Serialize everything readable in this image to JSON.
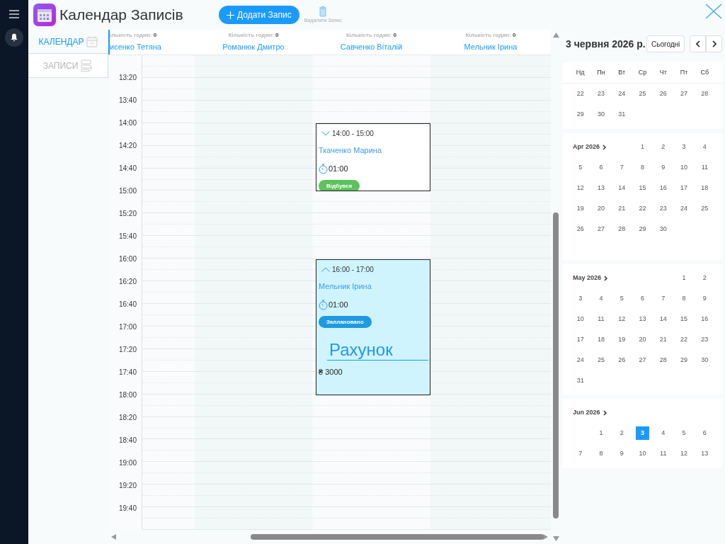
{
  "app": {
    "title": "Календар Записів",
    "add_button": "Додати Запис",
    "delete_button": "Видалити Запис"
  },
  "nav": [
    {
      "label": "КАЛЕНДАР",
      "kind": "calendar",
      "selected": true
    },
    {
      "label": "ЗАПИСИ",
      "kind": "records",
      "selected": false
    }
  ],
  "staff_columns": [
    {
      "hours_label": "ількість годин:",
      "hours": "0",
      "name": "исенко Тетяна"
    },
    {
      "hours_label": "Кількість годин:",
      "hours": "0",
      "name": "Романюк Дмитро"
    },
    {
      "hours_label": "Кількість годин:",
      "hours": "0",
      "name": "Савченко Віталій",
      "events": [
        {
          "time": "14:00 - 15:00",
          "client": "Ткаченко Марина",
          "duration": "01:00",
          "status": "Відбувся",
          "color": "#5cc35c",
          "expanded": false
        },
        {
          "time": "16:00 - 17:00",
          "client": "Мельник Ірина",
          "duration": "01:00",
          "status": "Заплановано",
          "color": "#1e9be0",
          "expanded": true,
          "invoice_label": "Рахунок",
          "amount": "₴ 3000"
        }
      ]
    },
    {
      "hours_label": "Кількість годин:",
      "hours": "0",
      "name": "Мельник Ірина"
    }
  ],
  "times": [
    "13:20",
    "13:40",
    "14:00",
    "14:20",
    "14:40",
    "15:00",
    "15:20",
    "15:40",
    "16:00",
    "16:20",
    "16:40",
    "17:00",
    "17:20",
    "17:40",
    "18:00",
    "18:20",
    "18:40",
    "19:00",
    "19:20",
    "19:40"
  ],
  "calendar": {
    "date_title": "3 червня 2026 р.",
    "today_button": "Сьогодні",
    "weekdays": [
      "Нд",
      "Пн",
      "Вт",
      "Ср",
      "Чт",
      "Пт",
      "Сб"
    ],
    "months": [
      {
        "weeks": [
          [
            {
              "d": "22",
              "selected": false
            },
            {
              "d": "23",
              "selected": false
            },
            {
              "d": "24",
              "selected": false
            },
            {
              "d": "25",
              "selected": false
            },
            {
              "d": "26",
              "selected": false
            },
            {
              "d": "27",
              "selected": false
            },
            {
              "d": "28",
              "selected": false
            }
          ],
          [
            {
              "d": "29",
              "selected": false
            },
            {
              "d": "30",
              "selected": false
            },
            {
              "d": "31",
              "selected": false
            }
          ]
        ]
      },
      {
        "label": "Apr 2026",
        "weeks": [
          [
            {
              "kind": "blank"
            },
            {
              "kind": "blank"
            },
            {
              "kind": "blank"
            },
            {
              "d": "1",
              "selected": false
            },
            {
              "d": "2",
              "selected": false
            },
            {
              "d": "3",
              "selected": false
            },
            {
              "d": "4",
              "selected": false
            }
          ],
          [
            {
              "d": "5",
              "selected": false
            },
            {
              "d": "6",
              "selected": false
            },
            {
              "d": "7",
              "selected": false
            },
            {
              "d": "8",
              "selected": false
            },
            {
              "d": "9",
              "selected": false
            },
            {
              "d": "10",
              "selected": false
            },
            {
              "d": "11",
              "selected": false
            }
          ],
          [
            {
              "d": "12",
              "selected": false
            },
            {
              "d": "13",
              "selected": false
            },
            {
              "d": "14",
              "selected": false
            },
            {
              "d": "15",
              "selected": false
            },
            {
              "d": "16",
              "selected": false
            },
            {
              "d": "17",
              "selected": false
            },
            {
              "d": "18",
              "selected": false
            }
          ],
          [
            {
              "d": "19",
              "selected": false
            },
            {
              "d": "20",
              "selected": false
            },
            {
              "d": "21",
              "selected": false
            },
            {
              "d": "22",
              "selected": false
            },
            {
              "d": "23",
              "selected": false
            },
            {
              "d": "24",
              "selected": false
            },
            {
              "d": "25",
              "selected": false
            }
          ],
          [
            {
              "d": "26",
              "selected": false
            },
            {
              "d": "27",
              "selected": false
            },
            {
              "d": "28",
              "selected": false
            },
            {
              "d": "29",
              "selected": false
            },
            {
              "d": "30",
              "selected": false
            }
          ]
        ]
      },
      {
        "label": "May 2026",
        "weeks": [
          [
            {
              "kind": "blank"
            },
            {
              "kind": "blank"
            },
            {
              "kind": "blank"
            },
            {
              "kind": "blank"
            },
            {
              "kind": "blank"
            },
            {
              "d": "1",
              "selected": false
            },
            {
              "d": "2",
              "selected": false
            }
          ],
          [
            {
              "d": "3",
              "selected": false
            },
            {
              "d": "4",
              "selected": false
            },
            {
              "d": "5",
              "selected": false
            },
            {
              "d": "6",
              "selected": false
            },
            {
              "d": "7",
              "selected": false
            },
            {
              "d": "8",
              "selected": false
            },
            {
              "d": "9",
              "selected": false
            }
          ],
          [
            {
              "d": "10",
              "selected": false
            },
            {
              "d": "11",
              "selected": false
            },
            {
              "d": "12",
              "selected": false
            },
            {
              "d": "13",
              "selected": false
            },
            {
              "d": "14",
              "selected": false
            },
            {
              "d": "15",
              "selected": false
            },
            {
              "d": "16",
              "selected": false
            }
          ],
          [
            {
              "d": "17",
              "selected": false
            },
            {
              "d": "18",
              "selected": false
            },
            {
              "d": "19",
              "selected": false
            },
            {
              "d": "20",
              "selected": false
            },
            {
              "d": "21",
              "selected": false
            },
            {
              "d": "22",
              "selected": false
            },
            {
              "d": "23",
              "selected": false
            }
          ],
          [
            {
              "d": "24",
              "selected": false
            },
            {
              "d": "25",
              "selected": false
            },
            {
              "d": "26",
              "selected": false
            },
            {
              "d": "27",
              "selected": false
            },
            {
              "d": "28",
              "selected": false
            },
            {
              "d": "29",
              "selected": false
            },
            {
              "d": "30",
              "selected": false
            }
          ],
          [
            {
              "d": "31",
              "selected": false
            }
          ]
        ]
      },
      {
        "label": "Jun 2026",
        "weeks": [
          [
            {
              "kind": "blank"
            },
            {
              "d": "1",
              "selected": false
            },
            {
              "d": "2",
              "selected": false
            },
            {
              "d": "3",
              "selected": true
            },
            {
              "d": "4",
              "selected": false
            },
            {
              "d": "5",
              "selected": false
            },
            {
              "d": "6",
              "selected": false
            }
          ],
          [
            {
              "d": "7",
              "selected": false
            },
            {
              "d": "8",
              "selected": false
            },
            {
              "d": "9",
              "selected": false
            },
            {
              "d": "10",
              "selected": false
            },
            {
              "d": "11",
              "selected": false
            },
            {
              "d": "12",
              "selected": false
            },
            {
              "d": "13",
              "selected": false
            }
          ]
        ]
      }
    ]
  }
}
